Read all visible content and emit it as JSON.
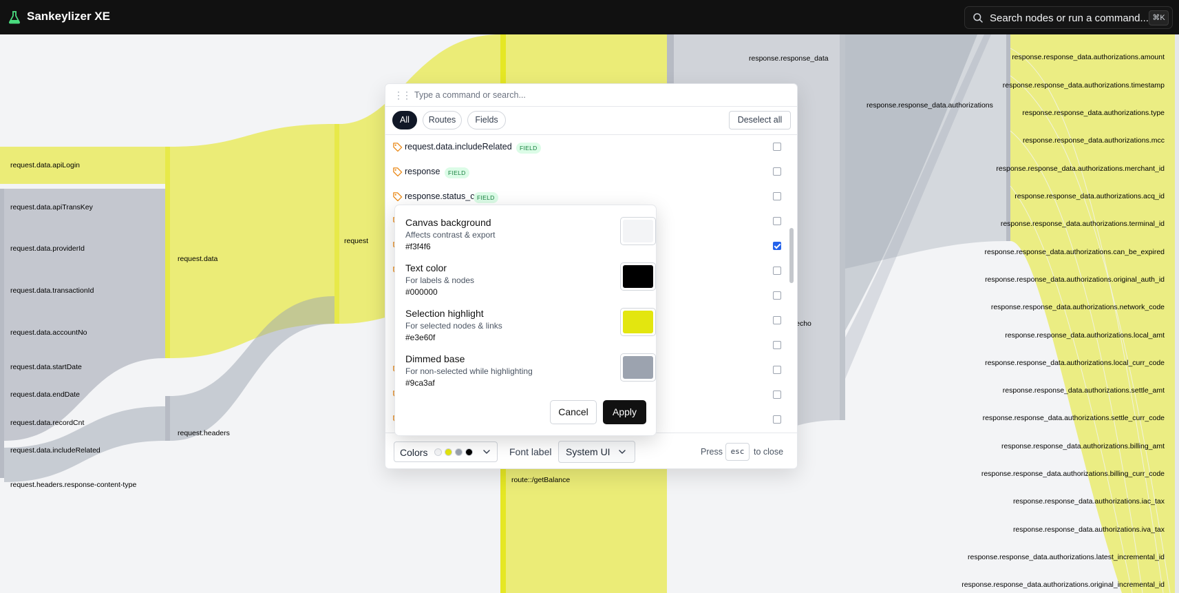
{
  "app": {
    "title": "Sankeylizer XE",
    "logo_icon": "flask-icon",
    "search_placeholder": "Search nodes or run a command...",
    "search_shortcut": "⌘K"
  },
  "colors": {
    "topbar": "#111111",
    "canvas_bg": "#f3f4f6",
    "highlight": "#e3e60f",
    "dimmed": "#9ca3af",
    "badge_bg": "#dcfce7",
    "badge_text": "#15803d",
    "checkbox_checked": "#2563eb"
  },
  "canvas": {
    "left_nodes": [
      "request.data.apiLogin",
      "request.data.apiTransKey",
      "request.data.providerId",
      "request.data.transactionId",
      "request.data.accountNo",
      "request.data.startDate",
      "request.data.endDate",
      "request.data.recordCnt",
      "request.data.includeRelated",
      "request.headers.response-content-type"
    ],
    "mid_nodes": {
      "request_data": "request.data",
      "request_headers": "request.headers",
      "request": "request",
      "route": "route::/getBalance",
      "response_data": "response.response_data",
      "authorizations": "response.response_data.authorizations",
      "echo": "response.echo"
    },
    "right_nodes": [
      "response.response_data.authorizations.amount",
      "response.response_data.authorizations.timestamp",
      "response.response_data.authorizations.type",
      "response.response_data.authorizations.mcc",
      "response.response_data.authorizations.merchant_id",
      "response.response_data.authorizations.acq_id",
      "response.response_data.authorizations.terminal_id",
      "response.response_data.authorizations.can_be_expired",
      "response.response_data.authorizations.original_auth_id",
      "response.response_data.authorizations.network_code",
      "response.response_data.authorizations.local_amt",
      "response.response_data.authorizations.local_curr_code",
      "response.response_data.authorizations.settle_amt",
      "response.response_data.authorizations.settle_curr_code",
      "response.response_data.authorizations.billing_amt",
      "response.response_data.authorizations.billing_curr_code",
      "response.response_data.authorizations.iac_tax",
      "response.response_data.authorizations.iva_tax",
      "response.response_data.authorizations.latest_incremental_id",
      "response.response_data.authorizations.original_incremental_id"
    ]
  },
  "palette": {
    "input_placeholder": "Type a command or search...",
    "filters": {
      "all": "All",
      "routes": "Routes",
      "fields": "Fields"
    },
    "deselect_all": "Deselect all",
    "results": [
      {
        "label": "request.data.includeRelated",
        "badge": "FIELD",
        "checked": false
      },
      {
        "label": "response",
        "badge": "FIELD",
        "checked": false
      },
      {
        "label": "response.status_code",
        "badge": "FIELD",
        "checked": false
      },
      {
        "checked": false
      },
      {
        "checked": true
      },
      {
        "checked": false
      },
      {
        "checked": false
      },
      {
        "checked": false
      },
      {
        "checked": false
      },
      {
        "checked": false
      },
      {
        "checked": false
      },
      {
        "checked": false
      }
    ],
    "footer": {
      "colors_label": "Colors",
      "colors_swatches": [
        "#f3f4f6",
        "#e3e60f",
        "#9ca3af",
        "#000000"
      ],
      "font_label": "Font label",
      "font_value": "System UI",
      "press": "Press",
      "esc": "esc",
      "to_close": "to close"
    }
  },
  "color_settings": {
    "items": [
      {
        "title": "Canvas background",
        "desc": "Affects contrast & export",
        "hex": "#f3f4f6",
        "color": "#f3f4f6"
      },
      {
        "title": "Text color",
        "desc": "For labels & nodes",
        "hex": "#000000",
        "color": "#000000"
      },
      {
        "title": "Selection highlight",
        "desc": "For selected nodes & links",
        "hex": "#e3e60f",
        "color": "#e3e60f"
      },
      {
        "title": "Dimmed base",
        "desc": "For non-selected while highlighting",
        "hex": "#9ca3af",
        "color": "#9ca3af"
      }
    ],
    "cancel": "Cancel",
    "apply": "Apply"
  }
}
